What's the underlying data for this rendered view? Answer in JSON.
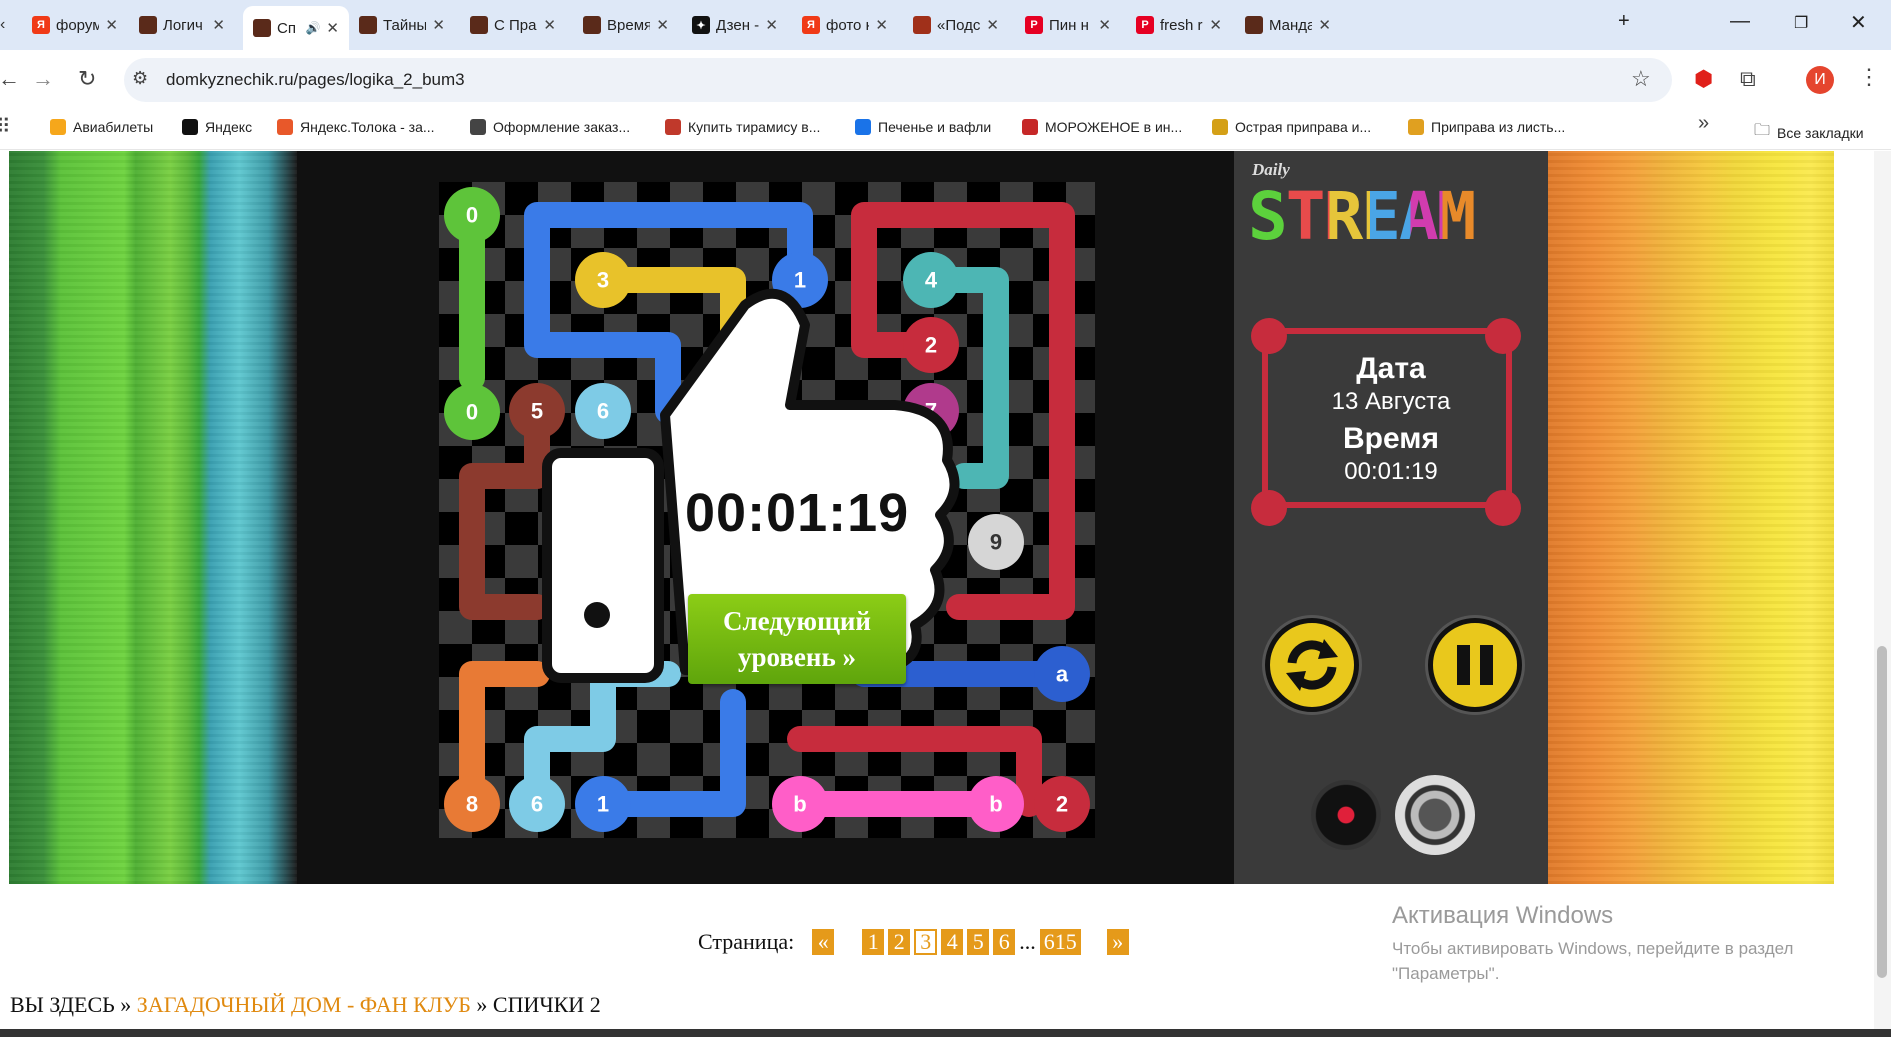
{
  "tabs": [
    {
      "title": "форум",
      "fav_color": "#f03a17",
      "fav_glyph": "Я"
    },
    {
      "title": "Логич",
      "fav_color": "#5a2a1a",
      "fav_glyph": ""
    },
    {
      "title": "Сп",
      "fav_color": "#5a2a1a",
      "fav_glyph": "",
      "active": true
    },
    {
      "title": "Тайны",
      "fav_color": "#5a2a1a",
      "fav_glyph": ""
    },
    {
      "title": "С Пра",
      "fav_color": "#5a2a1a",
      "fav_glyph": ""
    },
    {
      "title": "Время",
      "fav_color": "#5a2a1a",
      "fav_glyph": ""
    },
    {
      "title": "Дзен -",
      "fav_color": "#111111",
      "fav_glyph": "✦"
    },
    {
      "title": "фото к",
      "fav_color": "#f03a17",
      "fav_glyph": "Я"
    },
    {
      "title": "«Подс",
      "fav_color": "#a0301a",
      "fav_glyph": ""
    },
    {
      "title": "Пин н",
      "fav_color": "#e60023",
      "fav_glyph": "P"
    },
    {
      "title": "fresh r",
      "fav_color": "#e60023",
      "fav_glyph": "P"
    },
    {
      "title": "Манда",
      "fav_color": "#5a2a1a",
      "fav_glyph": ""
    }
  ],
  "address": {
    "url": "domkyznechik.ru/pages/logika_2_bum3"
  },
  "profile_letter": "И",
  "bookmarks": [
    {
      "label": "Авиабилеты",
      "color": "#f6a71b"
    },
    {
      "label": "Яндекс",
      "color": "#111111"
    },
    {
      "label": "Яндекс.Толока - за...",
      "color": "#e8582a"
    },
    {
      "label": "Оформление заказ...",
      "color": "#444444"
    },
    {
      "label": "Купить тирамису в...",
      "color": "#c0392b"
    },
    {
      "label": "Печенье и вафли",
      "color": "#1a73e8"
    },
    {
      "label": "МОРОЖЕНОЕ в ин...",
      "color": "#c62828"
    },
    {
      "label": "Острая приправа и...",
      "color": "#d4a017"
    },
    {
      "label": "Приправа из листь...",
      "color": "#e0a020"
    }
  ],
  "all_bookmarks": "Все закладки",
  "game": {
    "logo_daily": "Daily",
    "logo_stream": "STREAM",
    "date_label": "Дата",
    "date_value": "13 Августа",
    "time_label": "Время",
    "time_value": "00:01:19",
    "overlay_timer": "00:01:19",
    "next_level": "Следующий уровень »",
    "colors": {
      "frame": "#c72c3d",
      "button": "#e9c81c",
      "next": "#6fb812"
    }
  },
  "pagination": {
    "label": "Страница:",
    "prev": "«",
    "pages": [
      "1",
      "2",
      "3",
      "4",
      "5",
      "6"
    ],
    "current": "3",
    "dots": "...",
    "last": "615",
    "next": "»"
  },
  "breadcrumbs": {
    "prefix": "ВЫ ЗДЕСЬ »",
    "link": "ЗАГАДОЧНЫЙ ДОМ - ФАН КЛУБ",
    "sep": "»",
    "current": "СПИЧКИ 2"
  },
  "watermark": {
    "title": "Активация Windows",
    "text": "Чтобы активировать Windows, перейдите в раздел \"Параметры\"."
  }
}
